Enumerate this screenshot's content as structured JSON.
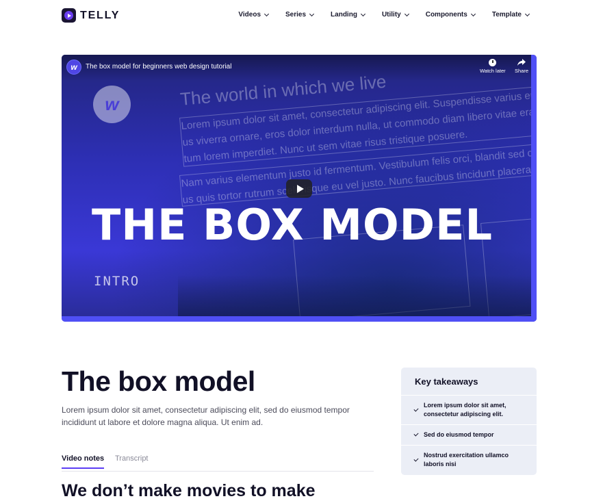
{
  "brand": {
    "name": "TELLY"
  },
  "nav": {
    "items": [
      {
        "label": "Videos"
      },
      {
        "label": "Series"
      },
      {
        "label": "Landing"
      },
      {
        "label": "Utility"
      },
      {
        "label": "Components"
      },
      {
        "label": "Template"
      }
    ]
  },
  "video": {
    "channel_initial": "w",
    "title": "The box model for beginners web design tutorial",
    "watch_later_label": "Watch later",
    "share_label": "Share",
    "logo_letter": "w",
    "thumbnail": {
      "heading": "The world in which we live",
      "para1_line1": "Lorem ipsum dolor sit amet, consectetur adipiscing elit. Suspendisse varius enim in eros ele",
      "para1_line2": "us viverra ornare, eros dolor interdum nulla, ut commodo diam libero vitae erat. Aenean fau",
      "para1_line3": "tum lorem imperdiet. Nunc ut sem vitae risus tristique posuere.",
      "para2_line1": "Nam varius elementum justo id fermentum. Vestibulum felis orci, blandit sed condimentum a",
      "para2_line2": "us quis tortor rutrum scelerisque eu vel justo. Nunc faucibus tincidunt placerat. Sus",
      "big_title": "THE BOX MODEL",
      "subtitle": "INTRO"
    }
  },
  "article": {
    "title": "The box model",
    "lead": "Lorem ipsum dolor sit amet, consectetur adipiscing elit, sed do eiusmod tempor incididunt ut labore et dolore magna aliqua. Ut enim ad.",
    "tabs": [
      {
        "label": "Video notes"
      },
      {
        "label": "Transcript"
      }
    ],
    "section_heading": "We don’t make movies to make"
  },
  "takeaways": {
    "title": "Key takeaways",
    "items": [
      {
        "text": "Lorem ipsum dolor sit amet, consectetur adipiscing elit."
      },
      {
        "text": "Sed do eiusmod tempor"
      },
      {
        "text": "Nostrud exercitation ullamco laboris nisi"
      }
    ]
  },
  "colors": {
    "accent": "#5b3df5",
    "text_dark": "#111026",
    "card_bg": "#ebeef6",
    "video_blue": "#4f4ff5"
  }
}
